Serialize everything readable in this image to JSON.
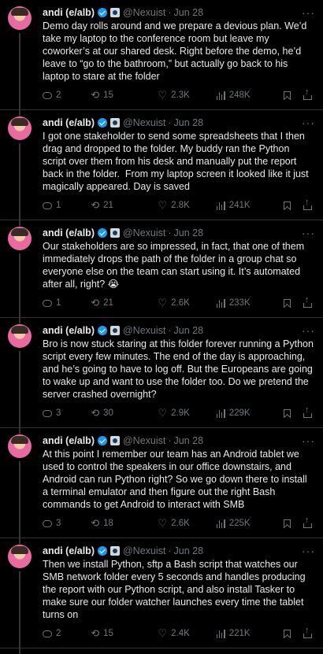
{
  "colors": {
    "background": "#000000",
    "text": "#e7e9ea",
    "muted": "#71767b",
    "verified": "#1d9bf0",
    "divider": "#2f3336"
  },
  "icons": [
    "avatar",
    "verified-icon",
    "affiliate-badge-icon",
    "more-icon",
    "reply-icon",
    "retweet-icon",
    "like-icon",
    "views-icon",
    "bookmark-icon",
    "share-icon"
  ],
  "more_label": "···",
  "tweets": [
    {
      "name": "andi (e/alb)",
      "handle": "@Nexuist",
      "date": "Jun 28",
      "text": "Demo day rolls around and we prepare a devious plan. We’d take my laptop to the conference room but leave my coworker’s at our shared desk. Right before the demo, he’d leave to “go to the bathroom,” but actually go back to his laptop to stare at the folder",
      "replies": "2",
      "retweets": "15",
      "likes": "2.3K",
      "views": "248K"
    },
    {
      "name": "andi (e/alb)",
      "handle": "@Nexuist",
      "date": "Jun 28",
      "text": "I got one stakeholder to send some spreadsheets that I then drag and dropped to the folder. My buddy ran the Python script over them from his desk and manually put the report back in the folder.  From my laptop screen it looked like it just magically appeared. Day is saved",
      "replies": "1",
      "retweets": "21",
      "likes": "2.8K",
      "views": "241K"
    },
    {
      "name": "andi (e/alb)",
      "handle": "@Nexuist",
      "date": "Jun 28",
      "text": "Our stakeholders are so impressed, in fact, that one of them immediately drops the path of the folder in a group chat so everyone else on the team can start using it. It’s automated after all, right? 😭",
      "replies": "1",
      "retweets": "21",
      "likes": "2.6K",
      "views": "233K"
    },
    {
      "name": "andi (e/alb)",
      "handle": "@Nexuist",
      "date": "Jun 28",
      "text": "Bro is now stuck staring at this folder forever running a Python script every few minutes. The end of the day is approaching, and he’s going to have to log off. But the Europeans are going to wake up and want to use the folder too. Do we pretend the server crashed overnight?",
      "replies": "3",
      "retweets": "30",
      "likes": "2.9K",
      "views": "229K"
    },
    {
      "name": "andi (e/alb)",
      "handle": "@Nexuist",
      "date": "Jun 28",
      "text": "At this point I remember our team has an Android tablet we used to control the speakers in our office downstairs, and Android can run Python right? So we go down there to install a terminal emulator and then figure out the right Bash commands to get Android to interact with SMB",
      "replies": "3",
      "retweets": "18",
      "likes": "2.6K",
      "views": "225K"
    },
    {
      "name": "andi (e/alb)",
      "handle": "@Nexuist",
      "date": "Jun 28",
      "text": "Then we install Python, sftp a Bash script that watches our SMB network folder every 5 seconds and handles producing the report with our Python script, and also install Tasker to make sure our folder watcher launches every time the tablet turns on",
      "replies": "2",
      "retweets": "15",
      "likes": "2.4K",
      "views": "221K"
    }
  ]
}
